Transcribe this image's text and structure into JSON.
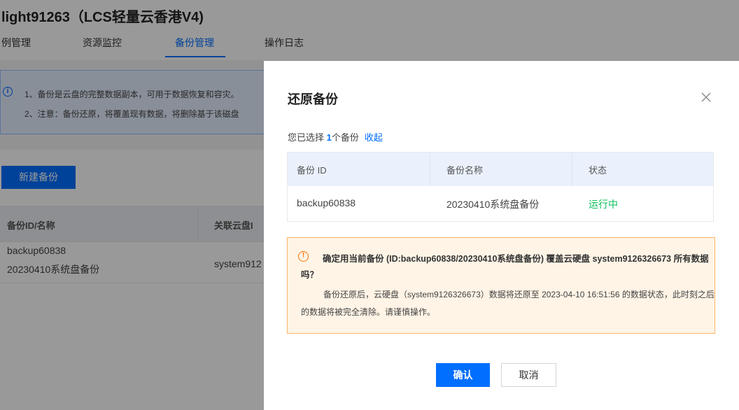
{
  "page": {
    "title": "light91263（LCS轻量云香港V4)",
    "tabs": [
      "例管理",
      "资源监控",
      "备份管理",
      "操作日志"
    ],
    "active_tab": "备份管理"
  },
  "notice": {
    "icon": "info-icon",
    "lines": [
      "1、备份是云盘的完整数据副本，可用于数据恢复和容灾。",
      "2、注意：备份还原，将覆盖现有数据，将删除基于该磁盘"
    ]
  },
  "backups": {
    "new_button": "新建备份",
    "columns": [
      "备份ID/名称",
      "关联云盘I"
    ],
    "rows": [
      {
        "id": "backup60838",
        "name": "20230410系统盘备份",
        "disk": "system912"
      }
    ]
  },
  "dialog": {
    "title": "还原备份",
    "close_icon": "close-icon",
    "selected_prefix": "您已选择 ",
    "selected_count": "1",
    "selected_suffix": "个备份",
    "collapse_label": "收起",
    "table": {
      "headers": [
        "备份 ID",
        "备份名称",
        "状态"
      ],
      "row": {
        "id": "backup60838",
        "name": "20230410系统盘备份",
        "status": "运行中"
      }
    },
    "warning": {
      "icon": "warning-icon",
      "title": "确定用当前备份 (ID:backup60838/20230410系统盘备份) 覆盖云硬盘 system9126326673 所有数据吗？",
      "body": "备份还原后，云硬盘（system9126326673）数据将还原至 2023-04-10 16:51:56 的数据状态，此时刻之后的数据将被完全清除。请谨慎操作。"
    },
    "confirm_label": "确认",
    "cancel_label": "取消"
  },
  "colors": {
    "accent": "#006eff",
    "status_running": "#0abf5b",
    "warning_border": "#ffb46a",
    "warning_bg": "#fff4e6"
  }
}
